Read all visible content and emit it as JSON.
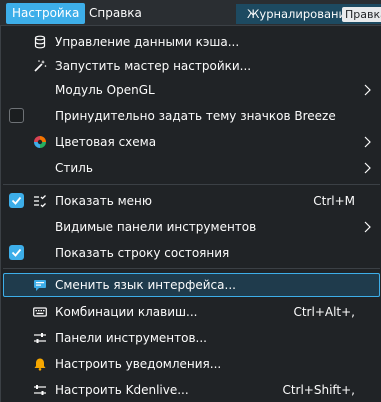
{
  "menubar": {
    "settings": "Настройка",
    "help": "Справка",
    "logging": "Журналирование",
    "tab": "Правка"
  },
  "menu": {
    "cache": "Управление данными кэша...",
    "wizard": "Запустить мастер настройки...",
    "opengl": "Модуль OpenGL",
    "breeze": "Принудительно задать тему значков Breeze",
    "color_scheme": "Цветовая схема",
    "style": "Стиль",
    "show_menu": "Показать меню",
    "show_menu_shortcut": "Ctrl+M",
    "toolbars": "Видимые панели инструментов",
    "statusbar": "Показать строку состояния",
    "language": "Сменить язык интерфейса...",
    "shortcuts": "Комбинации клавиш...",
    "shortcuts_shortcut": "Ctrl+Alt+,",
    "toolbars_config": "Панели инструментов...",
    "notifications": "Настроить уведомления...",
    "configure": "Настроить Kdenlive...",
    "configure_shortcut": "Ctrl+Shift+,"
  },
  "state": {
    "breeze_checked": false,
    "show_menu_checked": true,
    "statusbar_checked": true,
    "highlighted_item": "language"
  },
  "colors": {
    "accent": "#3daee9",
    "menu_bg": "#202326",
    "text": "#fcfcfc"
  }
}
